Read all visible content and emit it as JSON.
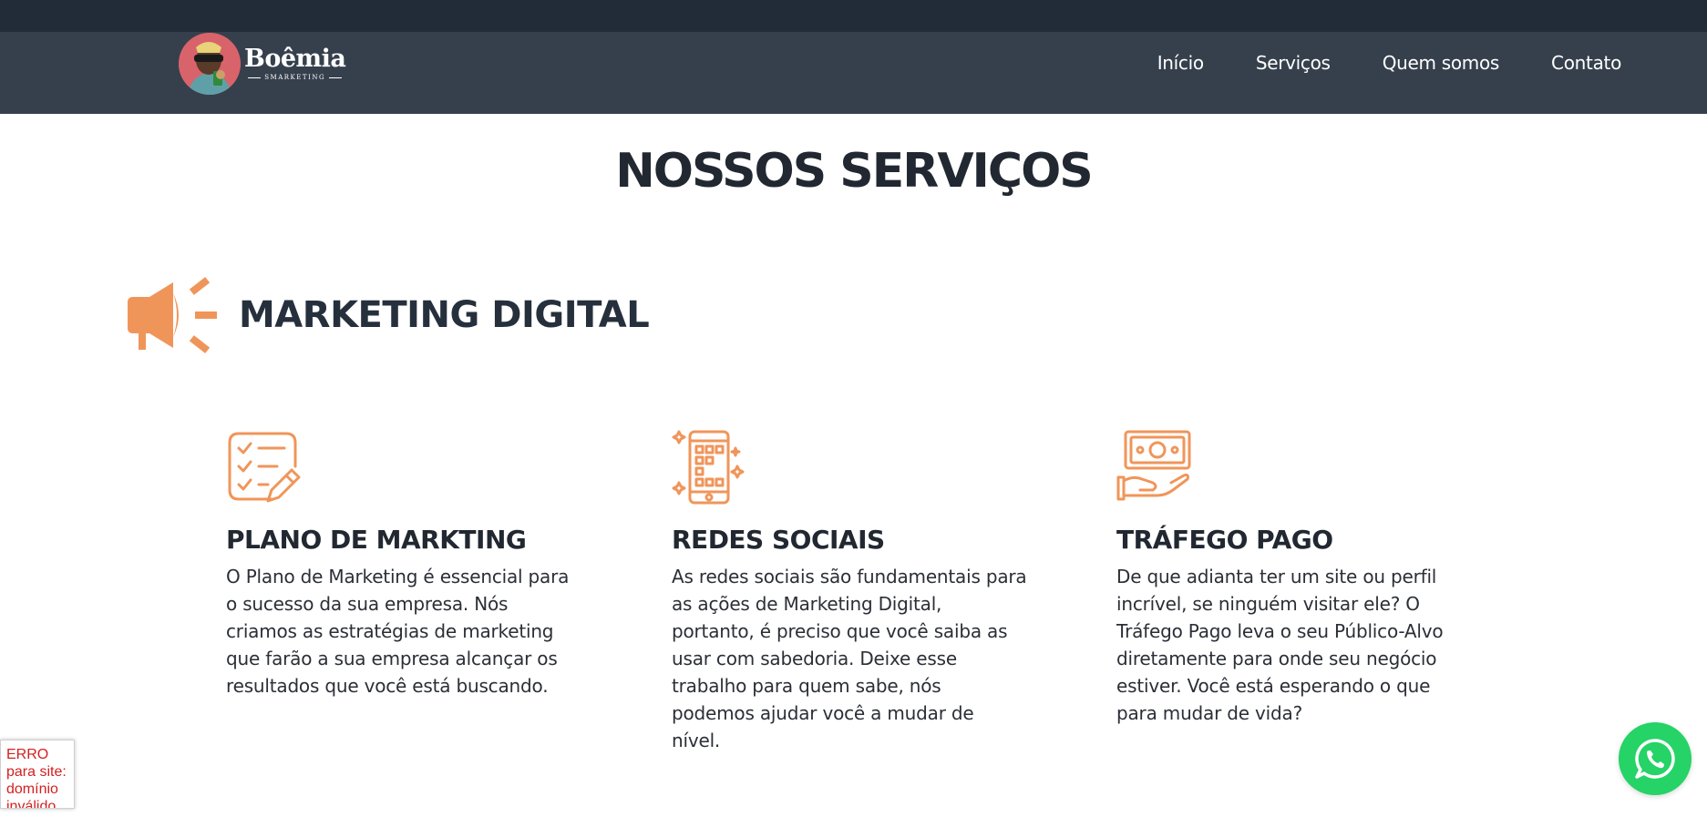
{
  "colors": {
    "accent": "#f0955a",
    "header_bg": "#36404d",
    "top_strip": "#222b38",
    "whatsapp": "#25d366",
    "error_text": "#d32020"
  },
  "logo": {
    "name": "Boêmia",
    "sub": "SMARKETING"
  },
  "nav": [
    {
      "label": "Início"
    },
    {
      "label": "Serviços"
    },
    {
      "label": "Quem somos"
    },
    {
      "label": "Contato"
    }
  ],
  "main": {
    "title": "NOSSOS SERVIÇOS",
    "category": {
      "title": "MARKETING DIGITAL",
      "icon": "megaphone-icon"
    },
    "cards": [
      {
        "icon": "checklist-pencil-icon",
        "title": "PLANO DE MARKTING",
        "text": "O Plano de Marketing é essencial para o sucesso da sua empresa. Nós criamos as estratégias de marketing que farão a sua empresa alcançar os resultados que você está buscando."
      },
      {
        "icon": "smartphone-apps-icon",
        "title": "REDES SOCIAIS",
        "text": "As redes sociais são fundamentais para as ações de Marketing Digital, portanto, é preciso que você saiba as usar com sabedoria. Deixe esse trabalho para quem sabe, nós podemos ajudar você a mudar de nível."
      },
      {
        "icon": "money-hand-icon",
        "title": "TRÁFEGO PAGO",
        "text": "De que adianta ter um site ou perfil incrível, se ninguém visitar ele? O Tráfego Pago leva o seu Público-Alvo diretamente para onde seu negócio estiver. Você está esperando o que para mudar de vida?"
      }
    ]
  },
  "error_box": {
    "text": "ERRO para site: domínio inválido do site"
  },
  "whatsapp": {
    "icon": "whatsapp-icon"
  }
}
